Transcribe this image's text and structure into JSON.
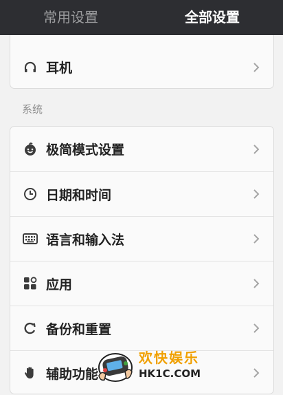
{
  "tabs": [
    {
      "label": "常用设置",
      "active": false
    },
    {
      "label": "全部设置",
      "active": true
    }
  ],
  "top_card": {
    "item": {
      "label": "耳机",
      "icon": "headphones-icon"
    }
  },
  "section": {
    "label": "系统"
  },
  "system_items": [
    {
      "label": "极简模式设置",
      "icon": "smiley-face-icon"
    },
    {
      "label": "日期和时间",
      "icon": "clock-icon"
    },
    {
      "label": "语言和输入法",
      "icon": "keyboard-icon"
    },
    {
      "label": "应用",
      "icon": "apps-grid-icon"
    },
    {
      "label": "备份和重置",
      "icon": "refresh-icon"
    },
    {
      "label": "辅助功能",
      "icon": "hand-icon"
    }
  ],
  "watermark": {
    "line1": "欢快娱乐",
    "line2": "HK1C.COM"
  },
  "colors": {
    "topbar": "#2d2e32",
    "background": "#f2f2f2",
    "card": "#fafafa",
    "watermark_accent": "#f0a000"
  }
}
